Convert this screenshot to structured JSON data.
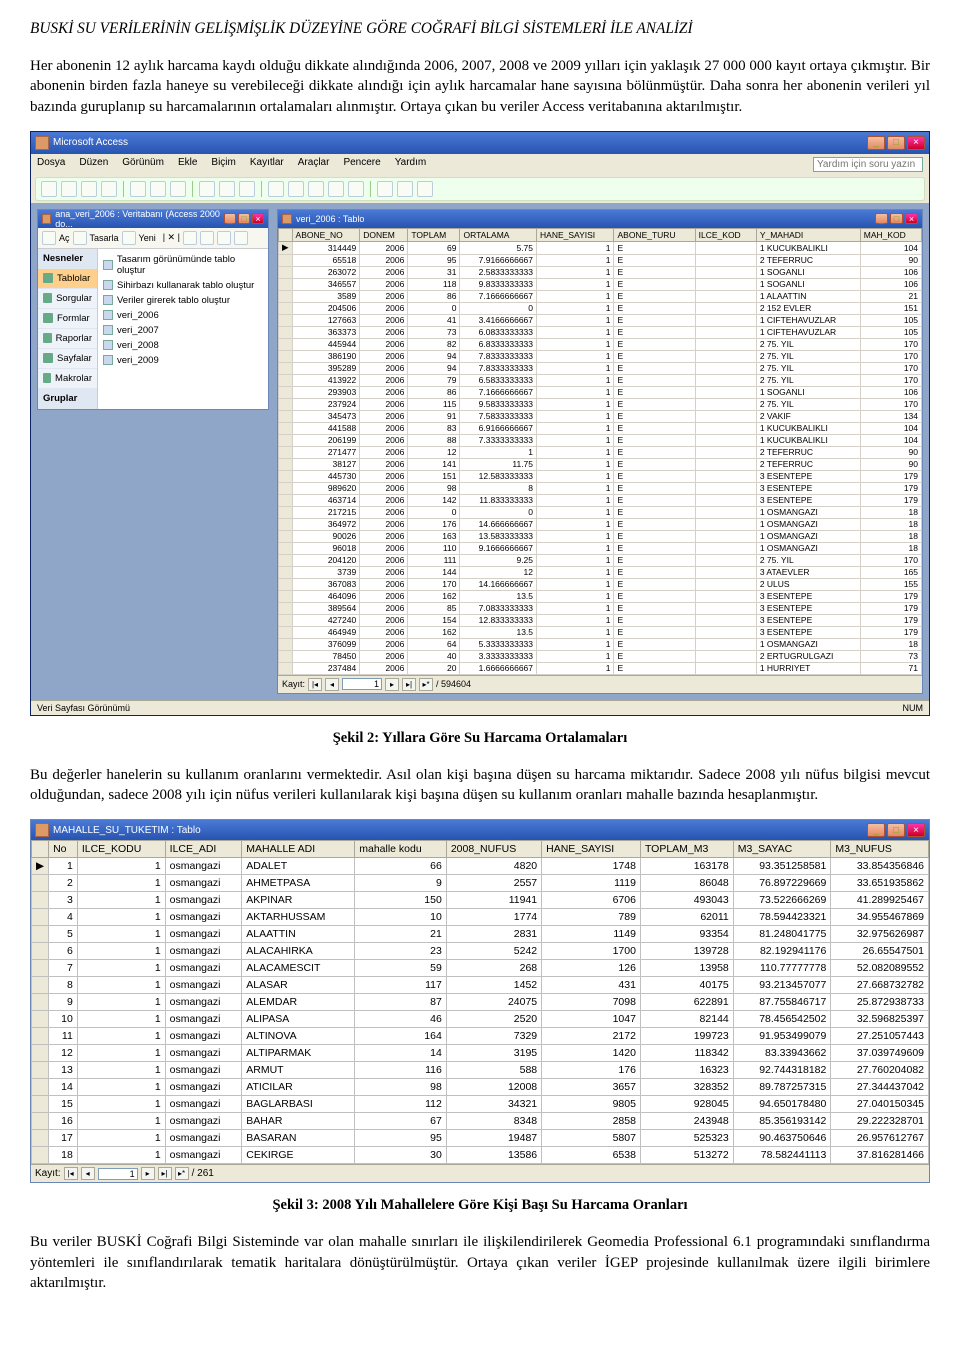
{
  "header_title": "BUSKİ SU VERİLERİNİN GELİŞMİŞLİK DÜZEYİNE GÖRE COĞRAFİ BİLGİ SİSTEMLERİ İLE ANALİZİ",
  "para1": "Her abonenin 12 aylık harcama kaydı olduğu dikkate alındığında 2006, 2007, 2008 ve 2009 yılları için yaklaşık 27 000 000 kayıt ortaya çıkmıştır. Bir abonenin birden fazla haneye su verebileceği dikkate alındığı için aylık harcamalar hane sayısına bölünmüştür. Daha sonra her abonenin verileri yıl bazında guruplanıp su harcamalarının ortalamaları alınmıştır. Ortaya çıkan bu veriler Access veritabanına aktarılmıştır.",
  "caption2": "Şekil 2: Yıllara Göre Su Harcama Ortalamaları",
  "para2": "Bu değerler hanelerin su kullanım oranlarını vermektedir. Asıl olan kişi başına düşen su harcama miktarıdır. Sadece 2008 yılı nüfus bilgisi mevcut olduğundan, sadece 2008 yılı için nüfus verileri kullanılarak kişi başına düşen su kullanım oranları mahalle bazında hesaplanmıştır.",
  "caption3": "Şekil 3: 2008 Yılı Mahallelere Göre Kişi Başı Su Harcama Oranları",
  "para3": "Bu veriler BUSKİ Coğrafi Bilgi Sisteminde var olan mahalle sınırları ile ilişkilendirilerek Geomedia Professional 6.1 programındaki sınıflandırma yöntemleri ile sınıflandırılarak tematik haritalara dönüştürülmüştür. Ortaya çıkan veriler İGEP projesinde kullanılmak üzere ilgili birimlere aktarılmıştır.",
  "access": {
    "app_title": "Microsoft Access",
    "menus": [
      "Dosya",
      "Düzen",
      "Görünüm",
      "Ekle",
      "Biçim",
      "Kayıtlar",
      "Araçlar",
      "Pencere",
      "Yardım"
    ],
    "help_placeholder": "Yardım için soru yazın",
    "db_title": "ana_veri_2006 : Veritabanı (Access 2000 do...",
    "db_tb": {
      "open": "Aç",
      "design": "Tasarla",
      "new": "Yeni"
    },
    "objects_header": "Nesneler",
    "objects": [
      "Tablolar",
      "Sorgular",
      "Formlar",
      "Raporlar",
      "Sayfalar",
      "Makrolar"
    ],
    "groups_header": "Gruplar",
    "selected_object": "Tablolar",
    "table_items": [
      "Tasarım görünümünde tablo oluştur",
      "Sihirbazı kullanarak tablo oluştur",
      "Veriler girerek tablo oluştur",
      "veri_2006",
      "veri_2007",
      "veri_2008",
      "veri_2009"
    ],
    "table_title": "veri_2006 : Tablo",
    "columns": [
      "ABONE_NO",
      "DONEM",
      "TOPLAM",
      "ORTALAMA",
      "HANE_SAYISI",
      "ABONE_TURU",
      "ILCE_KOD",
      "Y_MAHADI",
      "MAH_KOD"
    ],
    "rows": [
      [
        "314449",
        "2006",
        "69",
        "5.75",
        "1",
        "E",
        "",
        "1 KUCUKBALIKLI",
        "104"
      ],
      [
        "65518",
        "2006",
        "95",
        "7.9166666667",
        "1",
        "E",
        "",
        "2 TEFERRUC",
        "90"
      ],
      [
        "263072",
        "2006",
        "31",
        "2.5833333333",
        "1",
        "E",
        "",
        "1 SOGANLI",
        "106"
      ],
      [
        "346557",
        "2006",
        "118",
        "9.8333333333",
        "1",
        "E",
        "",
        "1 SOGANLI",
        "106"
      ],
      [
        "3589",
        "2006",
        "86",
        "7.1666666667",
        "1",
        "E",
        "",
        "1 ALAATTIN",
        "21"
      ],
      [
        "204506",
        "2006",
        "0",
        "0",
        "1",
        "E",
        "",
        "2 152 EVLER",
        "151"
      ],
      [
        "127663",
        "2006",
        "41",
        "3.4166666667",
        "1",
        "E",
        "",
        "1 CIFTEHAVUZLAR",
        "105"
      ],
      [
        "363373",
        "2006",
        "73",
        "6.0833333333",
        "1",
        "E",
        "",
        "1 CIFTEHAVUZLAR",
        "105"
      ],
      [
        "445944",
        "2006",
        "82",
        "6.8333333333",
        "1",
        "E",
        "",
        "2 75. YIL",
        "170"
      ],
      [
        "386190",
        "2006",
        "94",
        "7.8333333333",
        "1",
        "E",
        "",
        "2 75. YIL",
        "170"
      ],
      [
        "395289",
        "2006",
        "94",
        "7.8333333333",
        "1",
        "E",
        "",
        "2 75. YIL",
        "170"
      ],
      [
        "413922",
        "2006",
        "79",
        "6.5833333333",
        "1",
        "E",
        "",
        "2 75. YIL",
        "170"
      ],
      [
        "293903",
        "2006",
        "86",
        "7.1666666667",
        "1",
        "E",
        "",
        "1 SOGANLI",
        "106"
      ],
      [
        "237924",
        "2006",
        "115",
        "9.5833333333",
        "1",
        "E",
        "",
        "2 75. YIL",
        "170"
      ],
      [
        "345473",
        "2006",
        "91",
        "7.5833333333",
        "1",
        "E",
        "",
        "2 VAKIF",
        "134"
      ],
      [
        "441588",
        "2006",
        "83",
        "6.9166666667",
        "1",
        "E",
        "",
        "1 KUCUKBALIKLI",
        "104"
      ],
      [
        "206199",
        "2006",
        "88",
        "7.3333333333",
        "1",
        "E",
        "",
        "1 KUCUKBALIKLI",
        "104"
      ],
      [
        "271477",
        "2006",
        "12",
        "1",
        "1",
        "E",
        "",
        "2 TEFERRUC",
        "90"
      ],
      [
        "38127",
        "2006",
        "141",
        "11.75",
        "1",
        "E",
        "",
        "2 TEFERRUC",
        "90"
      ],
      [
        "445730",
        "2006",
        "151",
        "12.583333333",
        "1",
        "E",
        "",
        "3 ESENTEPE",
        "179"
      ],
      [
        "989620",
        "2006",
        "98",
        "8",
        "1",
        "E",
        "",
        "3 ESENTEPE",
        "179"
      ],
      [
        "463714",
        "2006",
        "142",
        "11.833333333",
        "1",
        "E",
        "",
        "3 ESENTEPE",
        "179"
      ],
      [
        "217215",
        "2006",
        "0",
        "0",
        "1",
        "E",
        "",
        "1 OSMANGAZI",
        "18"
      ],
      [
        "364972",
        "2006",
        "176",
        "14.666666667",
        "1",
        "E",
        "",
        "1 OSMANGAZI",
        "18"
      ],
      [
        "90026",
        "2006",
        "163",
        "13.583333333",
        "1",
        "E",
        "",
        "1 OSMANGAZI",
        "18"
      ],
      [
        "96018",
        "2006",
        "110",
        "9.1666666667",
        "1",
        "E",
        "",
        "1 OSMANGAZI",
        "18"
      ],
      [
        "204120",
        "2006",
        "111",
        "9.25",
        "1",
        "E",
        "",
        "2 75. YIL",
        "170"
      ],
      [
        "3739",
        "2006",
        "144",
        "12",
        "1",
        "E",
        "",
        "3 ATAEVLER",
        "165"
      ],
      [
        "367083",
        "2006",
        "170",
        "14.166666667",
        "1",
        "E",
        "",
        "2 ULUS",
        "155"
      ],
      [
        "464096",
        "2006",
        "162",
        "13.5",
        "1",
        "E",
        "",
        "3 ESENTEPE",
        "179"
      ],
      [
        "389564",
        "2006",
        "85",
        "7.0833333333",
        "1",
        "E",
        "",
        "3 ESENTEPE",
        "179"
      ],
      [
        "427240",
        "2006",
        "154",
        "12.833333333",
        "1",
        "E",
        "",
        "3 ESENTEPE",
        "179"
      ],
      [
        "464949",
        "2006",
        "162",
        "13.5",
        "1",
        "E",
        "",
        "3 ESENTEPE",
        "179"
      ],
      [
        "376099",
        "2006",
        "64",
        "5.3333333333",
        "1",
        "E",
        "",
        "1 OSMANGAZI",
        "18"
      ],
      [
        "78450",
        "2006",
        "40",
        "3.3333333333",
        "1",
        "E",
        "",
        "2 ERTUGRULGAZI",
        "73"
      ],
      [
        "237484",
        "2006",
        "20",
        "1.6666666667",
        "1",
        "E",
        "",
        "1 HURRIYET",
        "71"
      ]
    ],
    "record_label": "Kayıt:",
    "record_current": "1",
    "record_total": "/ 594604",
    "status_left": "Veri Sayfası Görünümü",
    "status_right": "NUM"
  },
  "dstable": {
    "title": "MAHALLE_SU_TUKETIM : Tablo",
    "columns": [
      "No",
      "ILCE_KODU",
      "ILCE_ADI",
      "MAHALLE ADI",
      "mahalle kodu",
      "2008_NUFUS",
      "HANE_SAYISI",
      "TOPLAM_M3",
      "M3_SAYAC",
      "M3_NUFUS"
    ],
    "rows": [
      [
        "1",
        "1",
        "osmangazi",
        "ADALET",
        "66",
        "4820",
        "1748",
        "163178",
        "93.351258581",
        "33.854356846"
      ],
      [
        "2",
        "1",
        "osmangazi",
        "AHMETPASA",
        "9",
        "2557",
        "1119",
        "86048",
        "76.897229669",
        "33.651935862"
      ],
      [
        "3",
        "1",
        "osmangazi",
        "AKPINAR",
        "150",
        "11941",
        "6706",
        "493043",
        "73.522666269",
        "41.289925467"
      ],
      [
        "4",
        "1",
        "osmangazi",
        "AKTARHUSSAM",
        "10",
        "1774",
        "789",
        "62011",
        "78.594423321",
        "34.955467869"
      ],
      [
        "5",
        "1",
        "osmangazi",
        "ALAATTIN",
        "21",
        "2831",
        "1149",
        "93354",
        "81.248041775",
        "32.975626987"
      ],
      [
        "6",
        "1",
        "osmangazi",
        "ALACAHIRKA",
        "23",
        "5242",
        "1700",
        "139728",
        "82.192941176",
        "26.65547501"
      ],
      [
        "7",
        "1",
        "osmangazi",
        "ALACAMESCIT",
        "59",
        "268",
        "126",
        "13958",
        "110.77777778",
        "52.082089552"
      ],
      [
        "8",
        "1",
        "osmangazi",
        "ALASAR",
        "117",
        "1452",
        "431",
        "40175",
        "93.213457077",
        "27.668732782"
      ],
      [
        "9",
        "1",
        "osmangazi",
        "ALEMDAR",
        "87",
        "24075",
        "7098",
        "622891",
        "87.755846717",
        "25.872938733"
      ],
      [
        "10",
        "1",
        "osmangazi",
        "ALIPASA",
        "46",
        "2520",
        "1047",
        "82144",
        "78.456542502",
        "32.596825397"
      ],
      [
        "11",
        "1",
        "osmangazi",
        "ALTINOVA",
        "164",
        "7329",
        "2172",
        "199723",
        "91.953499079",
        "27.251057443"
      ],
      [
        "12",
        "1",
        "osmangazi",
        "ALTIPARMAK",
        "14",
        "3195",
        "1420",
        "118342",
        "83.33943662",
        "37.039749609"
      ],
      [
        "13",
        "1",
        "osmangazi",
        "ARMUT",
        "116",
        "588",
        "176",
        "16323",
        "92.744318182",
        "27.760204082"
      ],
      [
        "14",
        "1",
        "osmangazi",
        "ATICILAR",
        "98",
        "12008",
        "3657",
        "328352",
        "89.787257315",
        "27.344437042"
      ],
      [
        "15",
        "1",
        "osmangazi",
        "BAGLARBASI",
        "112",
        "34321",
        "9805",
        "928045",
        "94.650178480",
        "27.040150345"
      ],
      [
        "16",
        "1",
        "osmangazi",
        "BAHAR",
        "67",
        "8348",
        "2858",
        "243948",
        "85.356193142",
        "29.222328701"
      ],
      [
        "17",
        "1",
        "osmangazi",
        "BASARAN",
        "95",
        "19487",
        "5807",
        "525323",
        "90.463750646",
        "26.957612767"
      ],
      [
        "18",
        "1",
        "osmangazi",
        "CEKIRGE",
        "30",
        "13586",
        "6538",
        "513272",
        "78.582441113",
        "37.816281466"
      ]
    ],
    "record_label": "Kayıt:",
    "record_current": "1",
    "record_total": "/ 261"
  }
}
